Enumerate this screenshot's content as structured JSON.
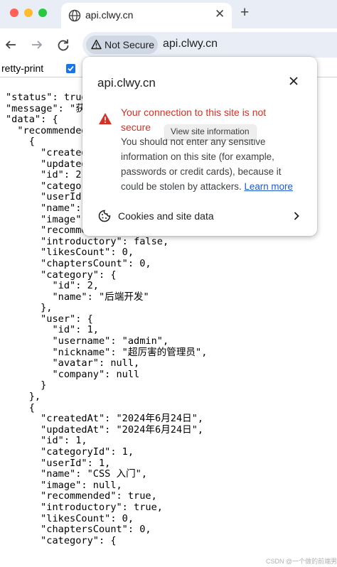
{
  "browser": {
    "tab_title": "api.clwy.cn",
    "security_chip_label": "Not Secure",
    "url": "api.clwy.cn"
  },
  "pretty_print": {
    "label": "retty-print",
    "checked": true
  },
  "json_text": "\"status\": true,\n\"message\": \"获\n\"data\": {\n  \"recommended\n    {\n      \"created\n      \"updated\n      \"id\": 2,\n      \"catego\n      \"userId\n      \"name\": \n      \"image\": \n      \"recommended\": true,\n      \"introductory\": false,\n      \"likesCount\": 0,\n      \"chaptersCount\": 0,\n      \"category\": {\n        \"id\": 2,\n        \"name\": \"后端开发\"\n      },\n      \"user\": {\n        \"id\": 1,\n        \"username\": \"admin\",\n        \"nickname\": \"超厉害的管理员\",\n        \"avatar\": null,\n        \"company\": null\n      }\n    },\n    {\n      \"createdAt\": \"2024年6月24日\",\n      \"updatedAt\": \"2024年6月24日\",\n      \"id\": 1,\n      \"categoryId\": 1,\n      \"userId\": 1,\n      \"name\": \"CSS 入门\",\n      \"image\": null,\n      \"recommended\": true,\n      \"introductory\": true,\n      \"likesCount\": 0,\n      \"chaptersCount\": 0,\n      \"category\": {",
  "popup": {
    "site": "api.clwy.cn",
    "warning_title": "Your connection to this site is not secure",
    "warning_body": "You should not enter any sensitive information on this site (for example, passwords or credit cards), because it could be stolen by attackers.",
    "learn_more": "Learn more",
    "cookies_label": "Cookies and site data"
  },
  "tooltip": "View site information",
  "watermark": "CSDN @一个做的前端男",
  "colors": {
    "warning": "#d93025",
    "link": "#1a59d1",
    "checkbox": "#1a73e8",
    "tabstrip": "#e9eef6"
  },
  "icons": [
    "globe-icon",
    "close-icon",
    "plus-icon",
    "back-arrow-icon",
    "forward-arrow-icon",
    "reload-icon",
    "warning-triangle-icon",
    "cookie-icon",
    "chevron-right-icon"
  ]
}
